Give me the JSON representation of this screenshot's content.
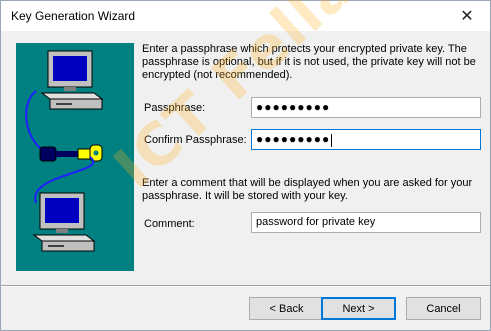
{
  "window": {
    "title": "Key Generation Wizard",
    "close_glyph": "✕"
  },
  "intro_text": "Enter a passphrase which protects your encrypted private key.  The passphrase is optional, but if it is not used, the private key will not be encrypted (not recommended).",
  "passphrase": {
    "label": "Passphrase:",
    "masked_value": "●●●●●●●●●"
  },
  "confirm_passphrase": {
    "label": "Confirm Passphrase:",
    "masked_value": "●●●●●●●●●"
  },
  "comment_intro": "Enter a comment that will be displayed when you are asked for your passphrase. It will be stored with your key.",
  "comment": {
    "label": "Comment:",
    "value": "password for private key"
  },
  "buttons": {
    "back": "< Back",
    "next": "Next >",
    "cancel": "Cancel"
  },
  "watermark_text": "ICT Fella",
  "colors": {
    "illustration_bg": "#008080",
    "focus_border": "#0078d7",
    "key_color": "#ffff00"
  },
  "icons": [
    "computer-icon",
    "key-icon",
    "computer-icon"
  ]
}
